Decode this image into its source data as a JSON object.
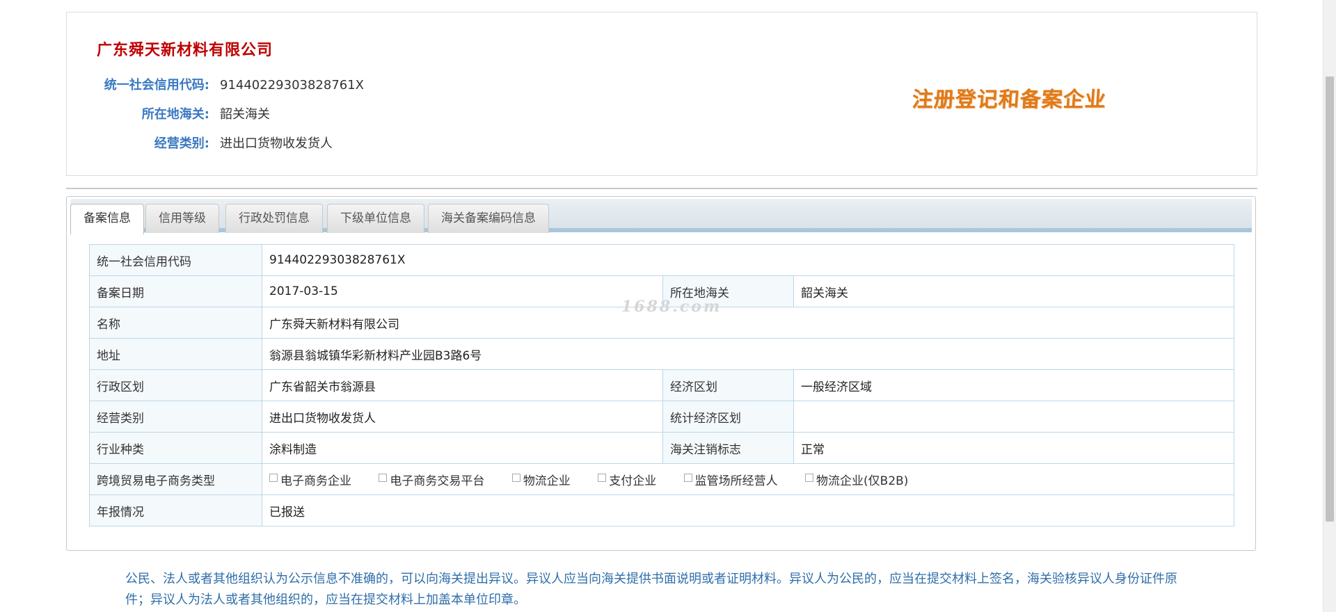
{
  "company": {
    "name": "广东舜天新材料有限公司",
    "fields": [
      {
        "label": "统一社会信用代码:",
        "value": "91440229303828761X"
      },
      {
        "label": "所在地海关:",
        "value": "韶关海关"
      },
      {
        "label": "经营类别:",
        "value": "进出口货物收发货人"
      }
    ],
    "status_stamp": "注册登记和备案企业"
  },
  "tabs": [
    {
      "label": "备案信息",
      "active": true
    },
    {
      "label": "信用等级",
      "active": false
    },
    {
      "label": "行政处罚信息",
      "active": false
    },
    {
      "label": "下级单位信息",
      "active": false
    },
    {
      "label": "海关备案编码信息",
      "active": false
    }
  ],
  "record": {
    "credit_code_label": "统一社会信用代码",
    "credit_code": "91440229303828761X",
    "record_date_label": "备案日期",
    "record_date": "2017-03-15",
    "customs_label": "所在地海关",
    "customs": "韶关海关",
    "name_label": "名称",
    "name": "广东舜天新材料有限公司",
    "address_label": "地址",
    "address": "翁源县翁城镇华彩新材料产业园B3路6号",
    "admin_region_label": "行政区划",
    "admin_region": "广东省韶关市翁源县",
    "econ_region_label": "经济区划",
    "econ_region": "一般经济区域",
    "business_type_label": "经营类别",
    "business_type": "进出口货物收发货人",
    "stat_region_label": "统计经济区划",
    "stat_region": "",
    "industry_label": "行业种类",
    "industry": "涂料制造",
    "cancel_flag_label": "海关注销标志",
    "cancel_flag": "正常",
    "ecommerce_label": "跨境贸易电子商务类型",
    "ecommerce_options": [
      "电子商务企业",
      "电子商务交易平台",
      "物流企业",
      "支付企业",
      "监管场所经营人",
      "物流企业(仅B2B)"
    ],
    "annual_report_label": "年报情况",
    "annual_report": "已报送"
  },
  "watermark": "1688.com",
  "notice": "公民、法人或者其他组织认为公示信息不准确的，可以向海关提出异议。异议人应当向海关提供书面说明或者证明材料。异议人为公民的，应当在提交材料上签名，海关验核异议人身份证件原件；异议人为法人或者其他组织的，应当在提交材料上加盖本单位印章。",
  "colors": {
    "company_name": "#c00000",
    "label_blue": "#3a79c2",
    "stamp_orange": "#e07a1a",
    "notice_blue": "#2f6ea9",
    "table_border": "#bcd7e6"
  }
}
